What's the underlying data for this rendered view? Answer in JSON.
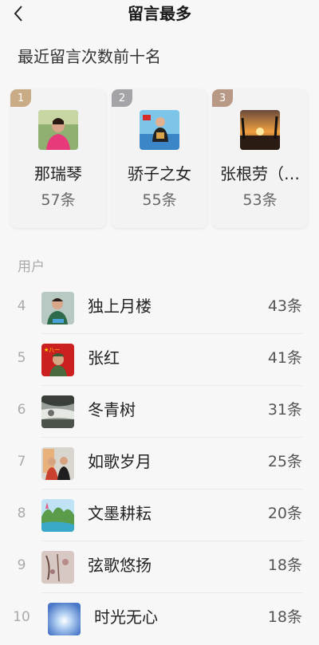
{
  "header": {
    "title": "留言最多"
  },
  "subtitle": "最近留言次数前十名",
  "podium": [
    {
      "rank": "1",
      "name": "那瑞琴",
      "count": "57条",
      "badge_color": "#c9ab86"
    },
    {
      "rank": "2",
      "name": "骄子之女",
      "count": "55条",
      "badge_color": "#a4a4a8"
    },
    {
      "rank": "3",
      "name": "张根劳（…",
      "count": "53条",
      "badge_color": "#b89985"
    }
  ],
  "section_label": "用户",
  "list": [
    {
      "rank": "4",
      "name": "独上月楼",
      "count": "43条"
    },
    {
      "rank": "5",
      "name": "张红",
      "count": "41条"
    },
    {
      "rank": "6",
      "name": "冬青树",
      "count": "31条"
    },
    {
      "rank": "7",
      "name": "如歌岁月",
      "count": "25条"
    },
    {
      "rank": "8",
      "name": "文墨耕耘",
      "count": "20条"
    },
    {
      "rank": "9",
      "name": "弦歌悠扬",
      "count": "18条"
    },
    {
      "rank": "10",
      "name": "时光无心",
      "count": "18条"
    }
  ]
}
